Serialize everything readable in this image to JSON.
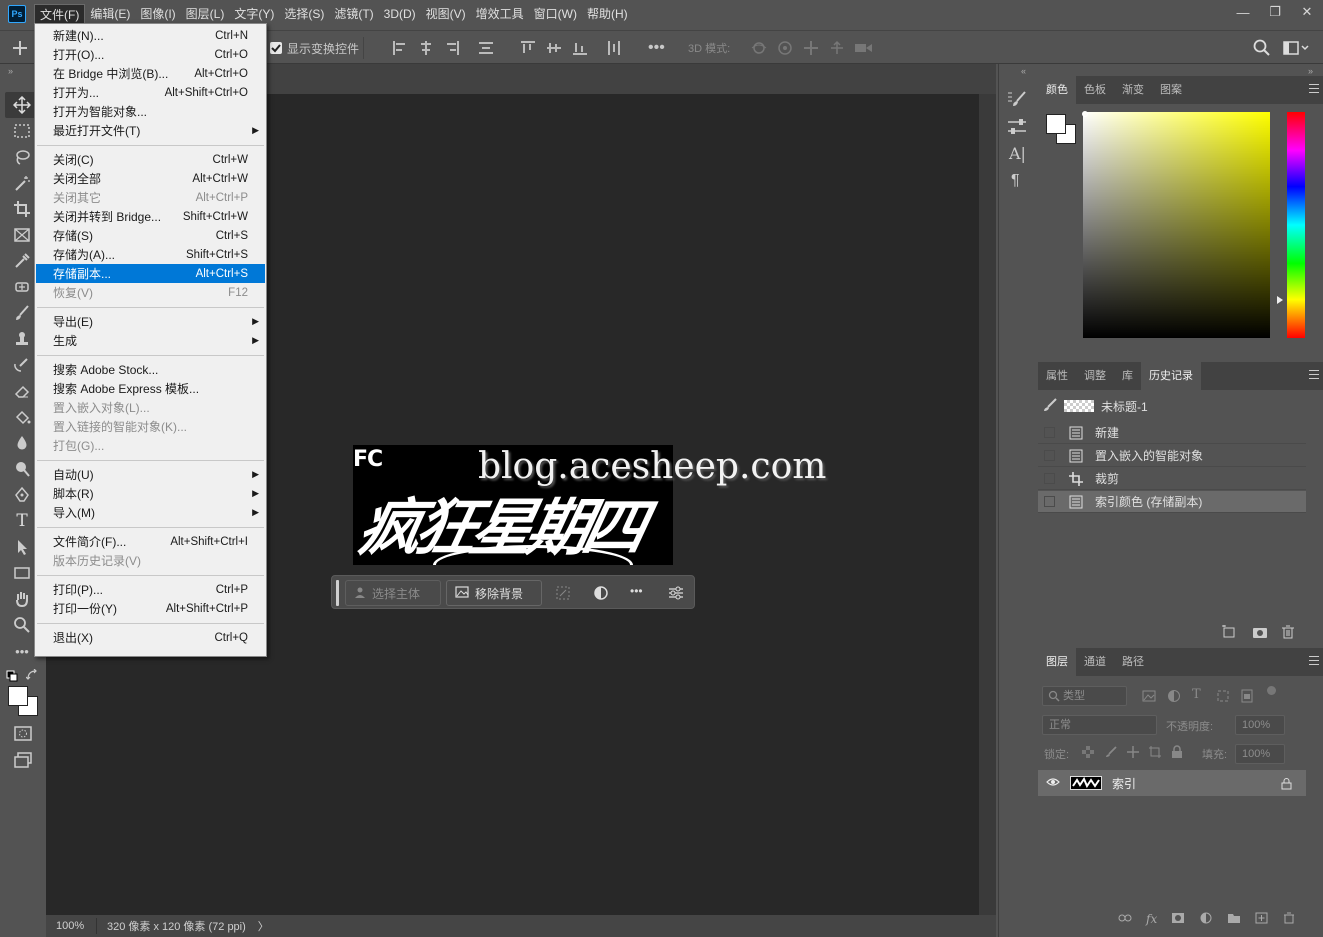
{
  "app": {
    "logo": "Ps"
  },
  "menubar": [
    "文件(F)",
    "编辑(E)",
    "图像(I)",
    "图层(L)",
    "文字(Y)",
    "选择(S)",
    "滤镜(T)",
    "3D(D)",
    "视图(V)",
    "增效工具",
    "窗口(W)",
    "帮助(H)"
  ],
  "window_controls": [
    "minimize-icon",
    "restore-icon",
    "close-icon"
  ],
  "optionsbar": {
    "show_transform_label": "显示变换控件",
    "show_transform_checked": true,
    "mode3d_label": "3D 模式:"
  },
  "file_menu": [
    {
      "label": "新建(N)...",
      "shortcut": "Ctrl+N"
    },
    {
      "label": "打开(O)...",
      "shortcut": "Ctrl+O"
    },
    {
      "label": "在 Bridge 中浏览(B)...",
      "shortcut": "Alt+Ctrl+O"
    },
    {
      "label": "打开为...",
      "shortcut": "Alt+Shift+Ctrl+O"
    },
    {
      "label": "打开为智能对象...",
      "shortcut": ""
    },
    {
      "label": "最近打开文件(T)",
      "shortcut": "",
      "submenu": true
    },
    {
      "sep": true
    },
    {
      "label": "关闭(C)",
      "shortcut": "Ctrl+W"
    },
    {
      "label": "关闭全部",
      "shortcut": "Alt+Ctrl+W"
    },
    {
      "label": "关闭其它",
      "shortcut": "Alt+Ctrl+P",
      "disabled": true
    },
    {
      "label": "关闭并转到 Bridge...",
      "shortcut": "Shift+Ctrl+W"
    },
    {
      "label": "存储(S)",
      "shortcut": "Ctrl+S"
    },
    {
      "label": "存储为(A)...",
      "shortcut": "Shift+Ctrl+S"
    },
    {
      "label": "存储副本...",
      "shortcut": "Alt+Ctrl+S",
      "highlighted": true
    },
    {
      "label": "恢复(V)",
      "shortcut": "F12",
      "disabled": true
    },
    {
      "sep": true
    },
    {
      "label": "导出(E)",
      "shortcut": "",
      "submenu": true
    },
    {
      "label": "生成",
      "shortcut": "",
      "submenu": true
    },
    {
      "sep": true
    },
    {
      "label": "搜索 Adobe Stock...",
      "shortcut": ""
    },
    {
      "label": "搜索 Adobe Express 模板...",
      "shortcut": ""
    },
    {
      "label": "置入嵌入对象(L)...",
      "shortcut": "",
      "disabled": true
    },
    {
      "label": "置入链接的智能对象(K)...",
      "shortcut": "",
      "disabled": true
    },
    {
      "label": "打包(G)...",
      "shortcut": "",
      "disabled": true
    },
    {
      "sep": true
    },
    {
      "label": "自动(U)",
      "shortcut": "",
      "submenu": true
    },
    {
      "label": "脚本(R)",
      "shortcut": "",
      "submenu": true
    },
    {
      "label": "导入(M)",
      "shortcut": "",
      "submenu": true
    },
    {
      "sep": true
    },
    {
      "label": "文件简介(F)...",
      "shortcut": "Alt+Shift+Ctrl+I"
    },
    {
      "label": "版本历史记录(V)",
      "shortcut": "",
      "disabled": true
    },
    {
      "sep": true
    },
    {
      "label": "打印(P)...",
      "shortcut": "Ctrl+P"
    },
    {
      "label": "打印一份(Y)",
      "shortcut": "Alt+Shift+Ctrl+P"
    },
    {
      "sep": true
    },
    {
      "label": "退出(X)",
      "shortcut": "Ctrl+Q"
    }
  ],
  "canvas": {
    "image_text": "疯狂星期四",
    "image_corner_text": "FC",
    "watermark": "blog.acesheep.com"
  },
  "taskbar": {
    "select_subject": "选择主体",
    "remove_background": "移除背景"
  },
  "statusbar": {
    "zoom": "100%",
    "doc_info": "320 像素 x 120 像素 (72 ppi)",
    "arrow": "〉"
  },
  "color_panel": {
    "tabs": [
      "颜色",
      "色板",
      "渐变",
      "图案"
    ],
    "active_tab": 0
  },
  "history_panel": {
    "tabs": [
      "属性",
      "调整",
      "库",
      "历史记录"
    ],
    "active_tab": 3,
    "snapshot": "未标题-1",
    "states": [
      "新建",
      "置入嵌入的智能对象",
      "裁剪",
      "索引颜色 (存储副本)"
    ],
    "selected_state": 3
  },
  "layers_panel": {
    "tabs": [
      "图层",
      "通道",
      "路径"
    ],
    "active_tab": 0,
    "filter_placeholder": "类型",
    "blend_mode": "正常",
    "opacity_label": "不透明度:",
    "opacity_value": "100%",
    "lock_label": "锁定:",
    "fill_label": "填充:",
    "fill_value": "100%",
    "layers": [
      {
        "name": "索引",
        "visible": true,
        "locked": true
      }
    ]
  },
  "colors": {
    "accent": "#0078d7",
    "panel_bg": "#535353",
    "canvas_bg": "#282828",
    "menu_bg": "#f0f0f0"
  }
}
